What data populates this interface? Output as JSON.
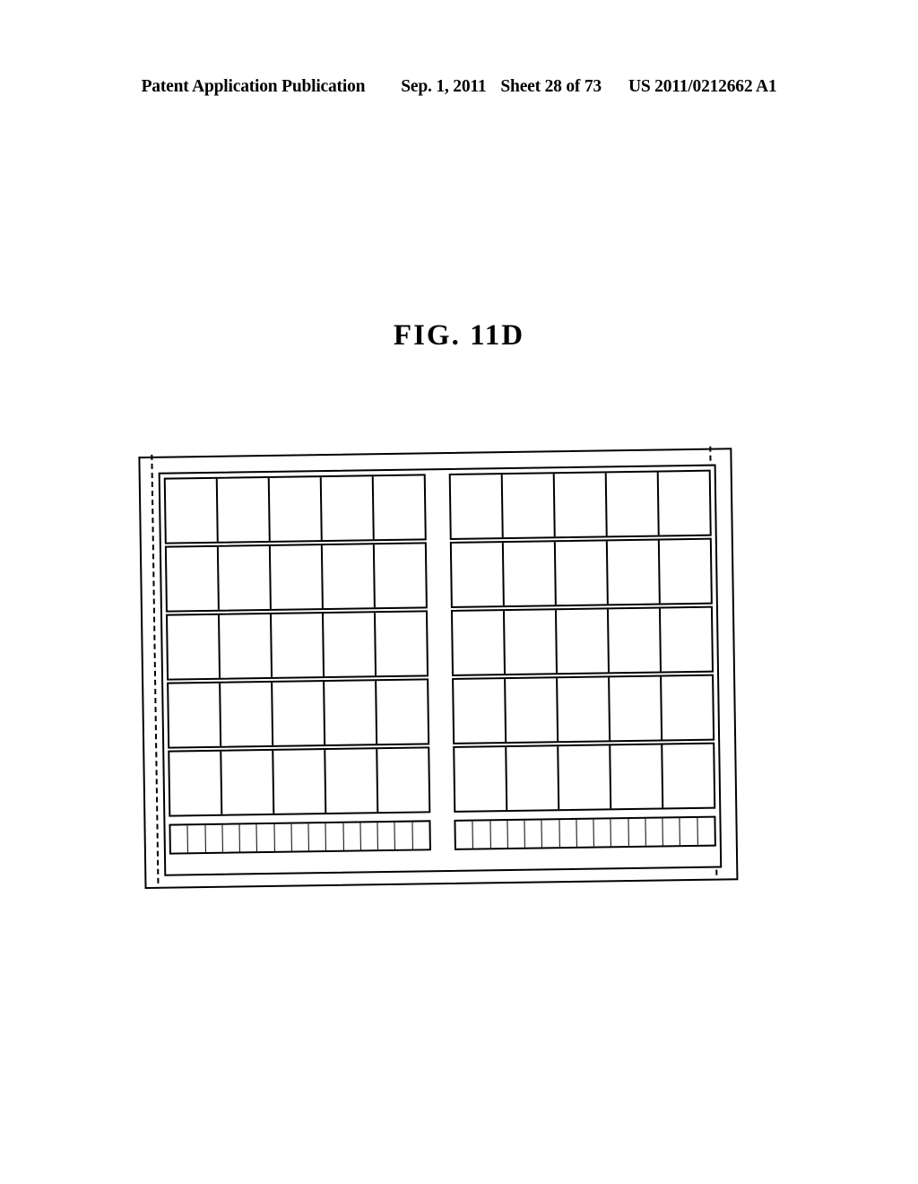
{
  "header": {
    "publication_label": "Patent Application Publication",
    "date": "Sep. 1, 2011",
    "sheet": "Sheet 28 of 73",
    "document_number": "US 2011/0212662 A1"
  },
  "figure": {
    "title": "FIG. 11D",
    "description": "Schematic plan view of a substrate panel divided into two blocks of cell areas with a bottom strip of narrow cells",
    "colors": {
      "line": "#000000",
      "background": "#ffffff"
    },
    "layout": {
      "outer_frame": "solid",
      "inner_frame": "solid",
      "guide_lines": "dashed",
      "dashed_line_count": 2,
      "block_columns": 2,
      "cell_rows": 5,
      "cells_per_row_per_block": 5,
      "total_large_cells": 50,
      "strip_rows": 1,
      "strip_cells_per_block": 15,
      "total_strip_cells": 30,
      "rotation_degrees": -0.85
    },
    "rows": [
      {
        "row_index": 0,
        "blocks": [
          {
            "block_index": 0,
            "cells": [
              "",
              "",
              "",
              "",
              ""
            ]
          },
          {
            "block_index": 1,
            "cells": [
              "",
              "",
              "",
              "",
              ""
            ]
          }
        ]
      },
      {
        "row_index": 1,
        "blocks": [
          {
            "block_index": 0,
            "cells": [
              "",
              "",
              "",
              "",
              ""
            ]
          },
          {
            "block_index": 1,
            "cells": [
              "",
              "",
              "",
              "",
              ""
            ]
          }
        ]
      },
      {
        "row_index": 2,
        "blocks": [
          {
            "block_index": 0,
            "cells": [
              "",
              "",
              "",
              "",
              ""
            ]
          },
          {
            "block_index": 1,
            "cells": [
              "",
              "",
              "",
              "",
              ""
            ]
          }
        ]
      },
      {
        "row_index": 3,
        "blocks": [
          {
            "block_index": 0,
            "cells": [
              "",
              "",
              "",
              "",
              ""
            ]
          },
          {
            "block_index": 1,
            "cells": [
              "",
              "",
              "",
              "",
              ""
            ]
          }
        ]
      },
      {
        "row_index": 4,
        "blocks": [
          {
            "block_index": 0,
            "cells": [
              "",
              "",
              "",
              "",
              ""
            ]
          },
          {
            "block_index": 1,
            "cells": [
              "",
              "",
              "",
              "",
              ""
            ]
          }
        ]
      }
    ],
    "strip": {
      "blocks": [
        {
          "block_index": 0,
          "cells": [
            "",
            "",
            "",
            "",
            "",
            "",
            "",
            "",
            "",
            "",
            "",
            "",
            "",
            "",
            ""
          ]
        },
        {
          "block_index": 1,
          "cells": [
            "",
            "",
            "",
            "",
            "",
            "",
            "",
            "",
            "",
            "",
            "",
            "",
            "",
            "",
            ""
          ]
        }
      ]
    }
  }
}
